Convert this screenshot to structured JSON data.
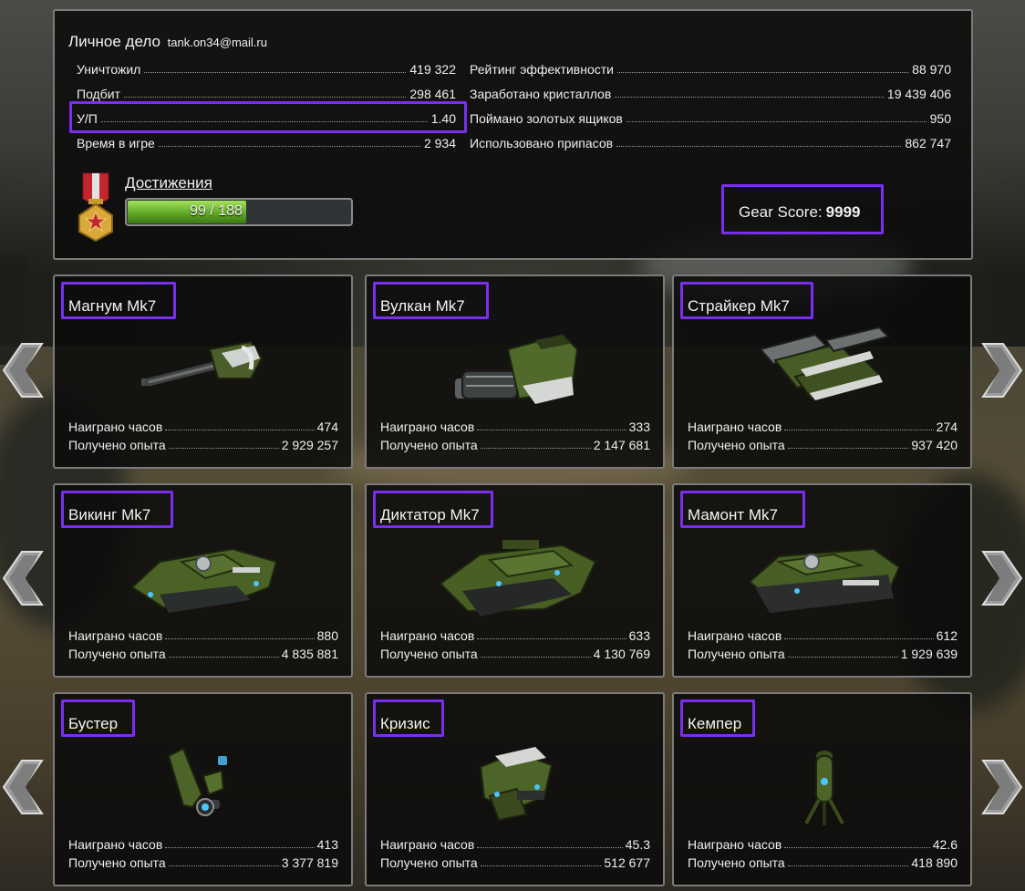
{
  "profile": {
    "title": "Личное дело",
    "email": "tank.on34@mail.ru",
    "left_stats": [
      {
        "label": "Уничтожил",
        "value": "419 322"
      },
      {
        "label": "Подбит",
        "value": "298 461"
      },
      {
        "label": "У/П",
        "value": "1.40"
      },
      {
        "label": "Время в игре",
        "value": "2 934"
      }
    ],
    "right_stats": [
      {
        "label": "Рейтинг эффективности",
        "value": "88 970"
      },
      {
        "label": "Заработано кристаллов",
        "value": "19 439 406"
      },
      {
        "label": "Поймано золотых ящиков",
        "value": "950"
      },
      {
        "label": "Использовано припасов",
        "value": "862 747"
      }
    ],
    "achievements_label": "Достижения",
    "achievements_progress": "99 / 188",
    "achievements_fraction": 0.527,
    "gear_label": "Gear Score:",
    "gear_value": "9999"
  },
  "stat_labels": {
    "hours": "Наиграно часов",
    "xp": "Получено опыта"
  },
  "items": [
    {
      "name": "Магнум Mk7",
      "hours": "474",
      "xp": "2 929 257",
      "art": "magnum-turret"
    },
    {
      "name": "Вулкан Mk7",
      "hours": "333",
      "xp": "2 147 681",
      "art": "vulcan-turret"
    },
    {
      "name": "Страйкер Mk7",
      "hours": "274",
      "xp": "937 420",
      "art": "striker-turret"
    },
    {
      "name": "Викинг Mk7",
      "hours": "880",
      "xp": "4 835 881",
      "art": "viking-hull"
    },
    {
      "name": "Диктатор Mk7",
      "hours": "633",
      "xp": "4 130 769",
      "art": "dictator-hull"
    },
    {
      "name": "Мамонт Mk7",
      "hours": "612",
      "xp": "1 929 639",
      "art": "mammoth-hull"
    },
    {
      "name": "Бустер",
      "hours": "413",
      "xp": "3 377 819",
      "art": "booster-drone"
    },
    {
      "name": "Кризис",
      "hours": "45.3",
      "xp": "512 677",
      "art": "crisis-drone"
    },
    {
      "name": "Кемпер",
      "hours": "42.6",
      "xp": "418 890",
      "art": "camper-drone"
    }
  ],
  "colors": {
    "highlight": "#7a2ff0",
    "progress_green": "#5ea825",
    "panel_border": "#7b7b7b"
  }
}
